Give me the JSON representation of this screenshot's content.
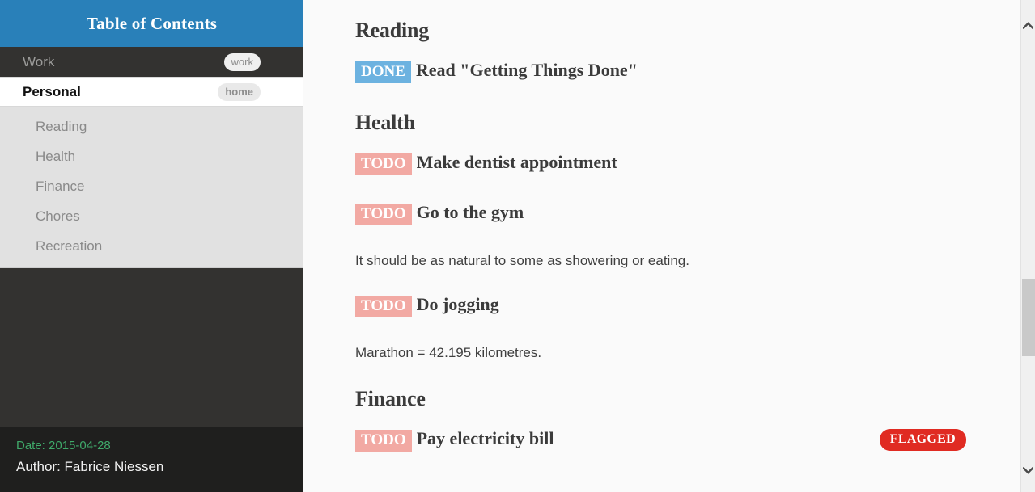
{
  "sidebar": {
    "header_title": "Table of Contents",
    "top_items": [
      {
        "label": "Work",
        "tag": "work",
        "active": false
      },
      {
        "label": "Personal",
        "tag": "home",
        "active": true
      }
    ],
    "sub_items": [
      {
        "label": "Reading"
      },
      {
        "label": "Health"
      },
      {
        "label": "Finance"
      },
      {
        "label": "Chores"
      },
      {
        "label": "Recreation"
      }
    ],
    "footer": {
      "date": "Date: 2015-04-28",
      "author": "Author: Fabrice Niessen"
    }
  },
  "main": {
    "sections": [
      {
        "heading": "Reading",
        "blocks": [
          {
            "type": "task",
            "keyword": "DONE",
            "text": "Read \"Getting Things Done\"",
            "flag": null
          }
        ]
      },
      {
        "heading": "Health",
        "blocks": [
          {
            "type": "task",
            "keyword": "TODO",
            "text": "Make dentist appointment",
            "flag": null
          },
          {
            "type": "task",
            "keyword": "TODO",
            "text": "Go to the gym",
            "flag": null
          },
          {
            "type": "para",
            "text": "It should be as natural to some as showering or eating."
          },
          {
            "type": "task",
            "keyword": "TODO",
            "text": "Do jogging",
            "flag": null
          },
          {
            "type": "para",
            "text": "Marathon = 42.195 kilometres."
          }
        ]
      },
      {
        "heading": "Finance",
        "blocks": [
          {
            "type": "task",
            "keyword": "TODO",
            "text": "Pay electricity bill",
            "flag": "FLAGGED"
          }
        ]
      }
    ]
  },
  "scrollbar": {
    "up_icon": "chevron-up-icon",
    "down_icon": "chevron-down-icon"
  },
  "colors": {
    "header_blue": "#2980b9",
    "sidebar_dark": "#333230",
    "sidebar_footer": "#1f1f1e",
    "sub_bg": "#e1e1e1",
    "todo": "#f2a9a3",
    "done": "#6cb2e0",
    "flagged": "#e02b22",
    "date_green": "#3fa96a"
  }
}
